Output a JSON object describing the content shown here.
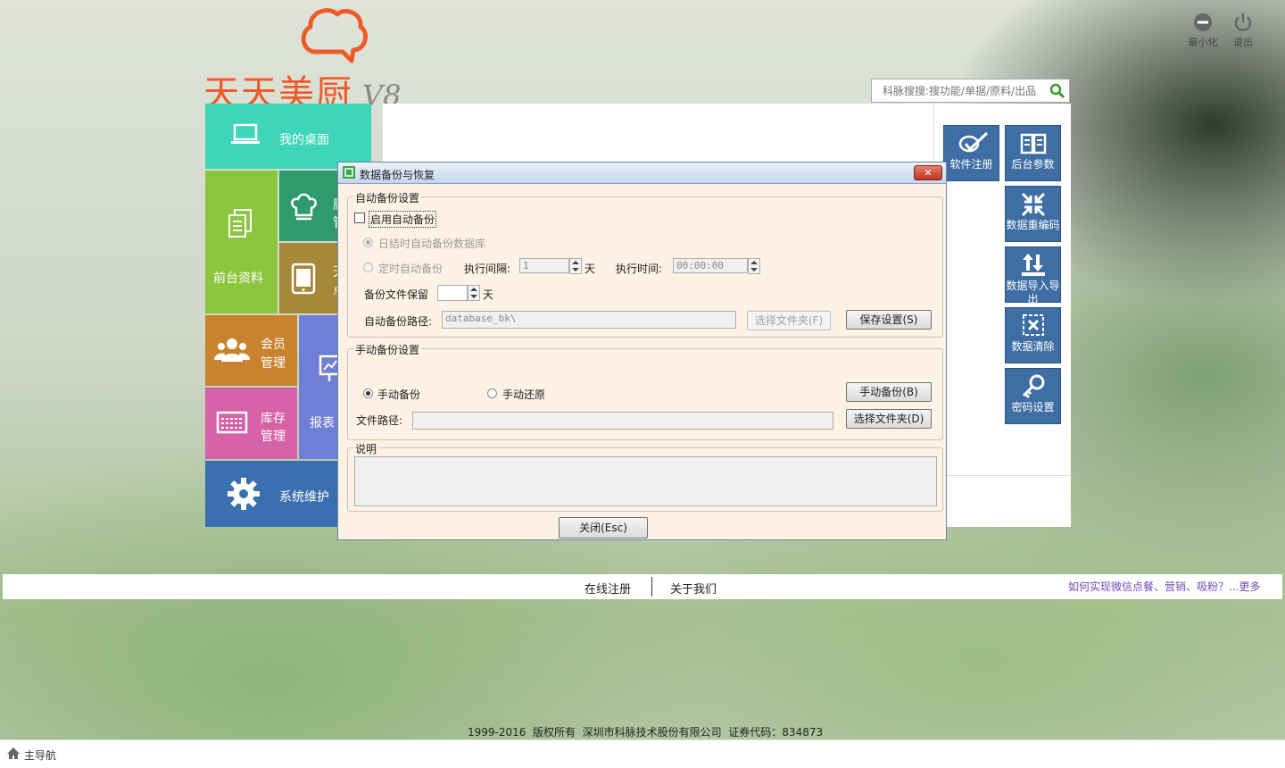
{
  "window": {
    "minimize_label": "最小化",
    "exit_label": "退出"
  },
  "logo": {
    "name": "天天美厨",
    "version": "V8"
  },
  "search": {
    "placeholder": "科脉搜搜:搜功能/单据/原料/出品"
  },
  "tiles": {
    "desktop": "我的桌面",
    "front_data": "前台资料",
    "kitchen": "厨",
    "kitchen_2": "管",
    "wechat": "天",
    "wechat_2": "点",
    "member_1": "会员",
    "member_2": "管理",
    "stock_1": "库存",
    "stock_2": "管理",
    "report": "报表",
    "system": "系统维护"
  },
  "right_buttons": [
    {
      "label": "软件注册",
      "icon": "register-icon"
    },
    {
      "label": "后台参数",
      "icon": "book-icon"
    },
    {
      "label": "数据重编码",
      "icon": "compress-icon"
    },
    {
      "label": "数据导入导出",
      "icon": "import-export-icon"
    },
    {
      "label": "数据清除",
      "icon": "clear-icon"
    },
    {
      "label": "密码设置",
      "icon": "key-icon"
    }
  ],
  "dialog": {
    "title": "数据备份与恢复",
    "auto_group": "自动备份设置",
    "enable_auto": "启用自动备份",
    "daily_auto": "日结时自动备份数据库",
    "timed_auto": "定时自动备份",
    "interval_label": "执行间隔:",
    "interval_value": "1",
    "day_unit": "天",
    "time_label": "执行时间:",
    "time_value": "00:00:00",
    "keep_label": "备份文件保留",
    "keep_value": "",
    "keep_unit": "天",
    "path_label": "自动备份路径:",
    "path_value": "database_bk\\",
    "choose_folder_disabled": "选择文件夹(F)",
    "save_settings": "保存设置(S)",
    "manual_group": "手动备份设置",
    "manual_backup_radio": "手动备份",
    "manual_restore_radio": "手动还原",
    "manual_backup_button": "手动备份(B)",
    "file_path_label": "文件路径:",
    "file_path_value": "",
    "choose_folder": "选择文件夹(D)",
    "notes_group": "说明",
    "notes_value": "",
    "close_button": "关闭(Esc)"
  },
  "links": {
    "online_register": "在线注册",
    "about_us": "关于我们",
    "promo": "如何实现微信点餐、营销、吸粉？...更多"
  },
  "copyright": "1999-2016  版权所有  深圳市科脉技术股份有限公司  证券代码：834873",
  "footer": {
    "home_label": "主导航"
  },
  "colors": {
    "accent_orange": "#ef5a2a",
    "tile_teal": "#3dd6b8",
    "tile_green": "#8cc63f",
    "tile_darkgreen": "#2f9a6e",
    "tile_olive": "#a7873a",
    "tile_orange": "#c9822e",
    "tile_pink": "#d662a7",
    "tile_blue": "#6f7fd6",
    "tile_navy": "#3a6fb0",
    "right_btn_blue": "#3e6ea4",
    "link_purple": "#6f4bb4"
  }
}
